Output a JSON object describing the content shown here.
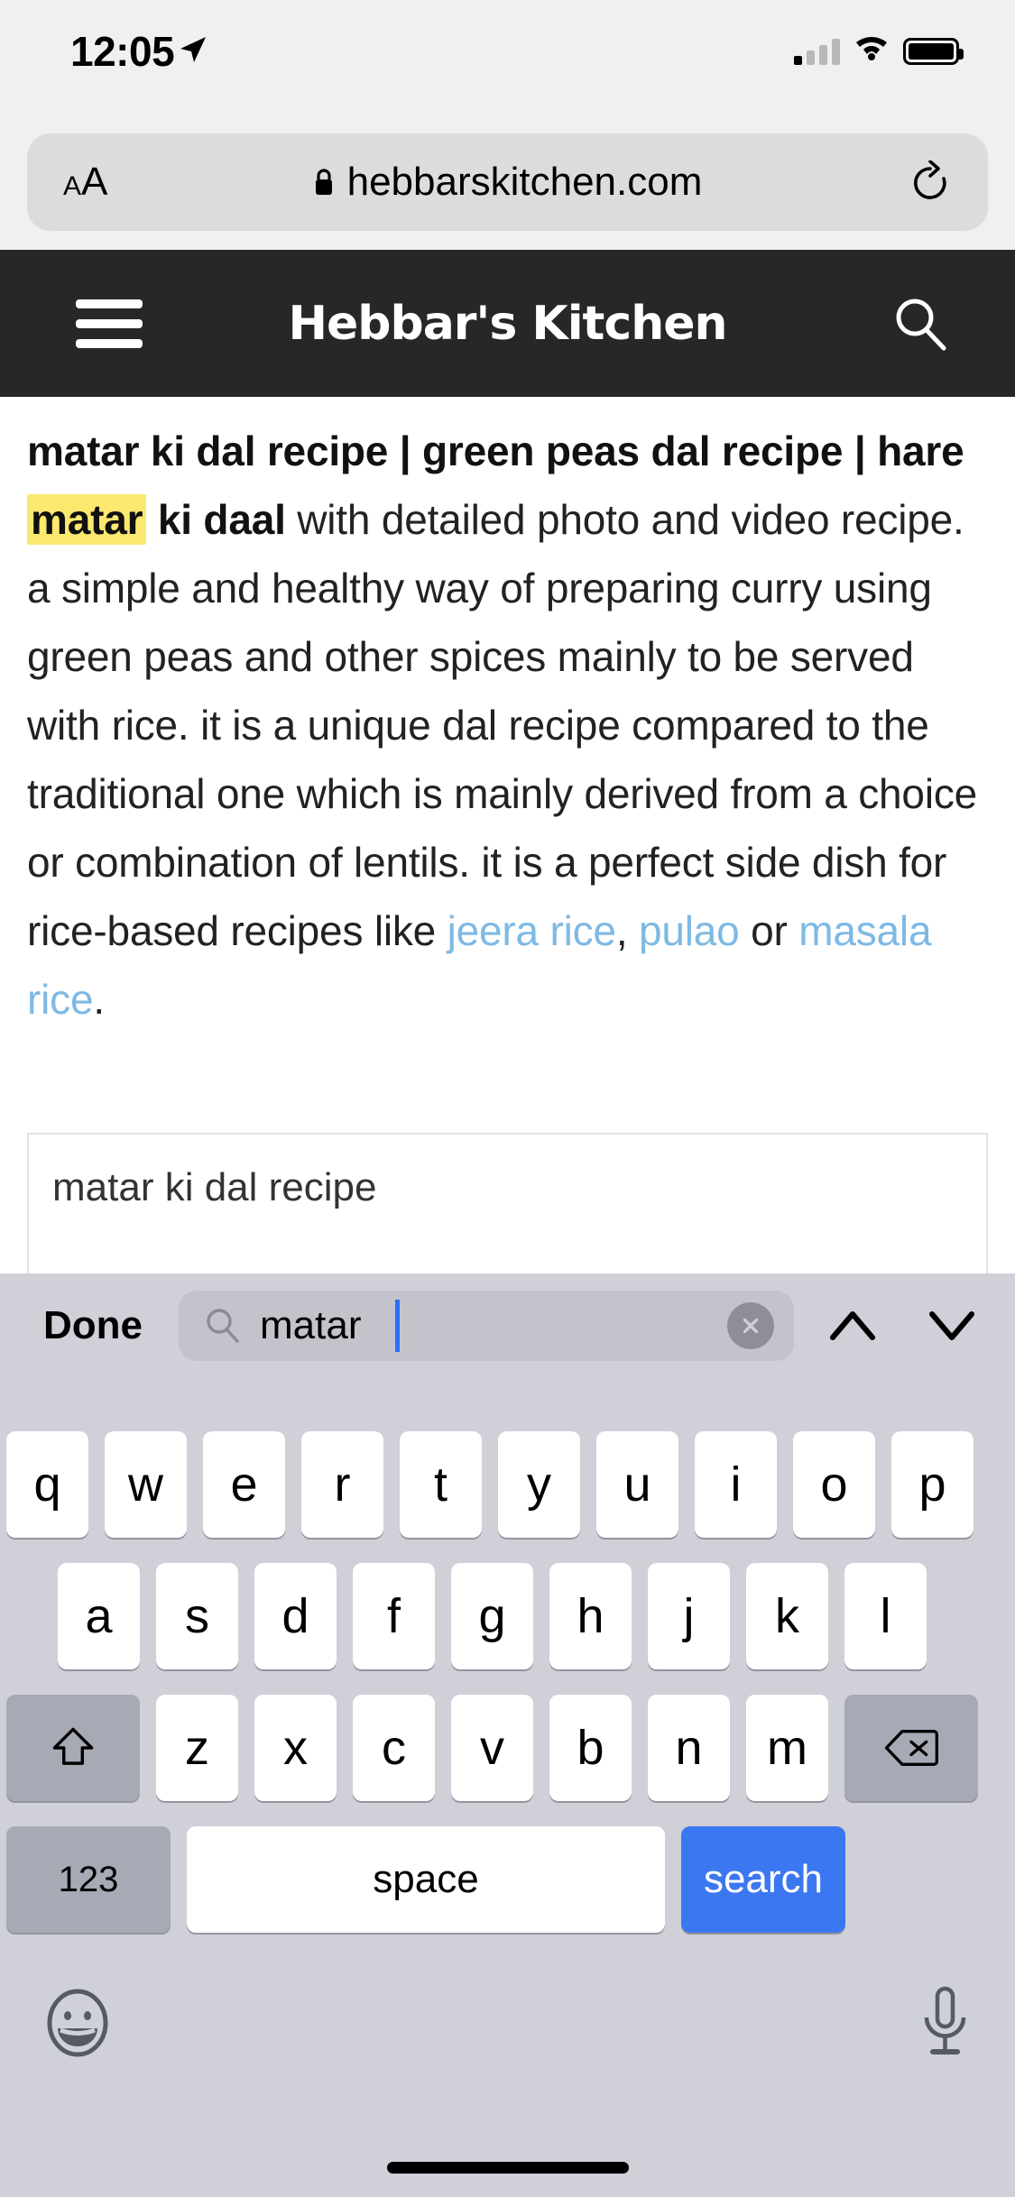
{
  "status_bar": {
    "time": "12:05",
    "location_icon": "location-arrow-icon",
    "cellular_icon": "signal-bars-icon",
    "wifi_icon": "wifi-icon",
    "battery_icon": "battery-full-icon"
  },
  "browser": {
    "text_size_label": "AA",
    "lock_icon": "lock-icon",
    "url": "hebbarskitchen.com",
    "reload_icon": "reload-icon"
  },
  "site_header": {
    "menu_icon": "hamburger-menu-icon",
    "title": "Hebbar's Kitchen",
    "search_icon": "search-icon",
    "background_color": "#272727"
  },
  "article": {
    "bold_part_1": "matar ki dal recipe | green peas dal recipe | hare ",
    "highlight_1": "matar",
    "bold_part_2": " ki daal",
    "body_1": " with detailed photo and video recipe. a simple and healthy way of preparing curry using green peas and other spices mainly to be served with rice. it is a unique dal recipe compared to the traditional one which is mainly derived from a choice or combination of lentils. it is a perfect side dish for rice-based recipes like ",
    "link_1": "jeera rice",
    "sep_1": ", ",
    "link_2": "pulao",
    "sep_2": " or ",
    "link_3": "masala rice",
    "body_end": ".",
    "highlight_color": "#fbe86e",
    "link_color": "#7eb9e4"
  },
  "result_box": {
    "text": "matar ki dal recipe"
  },
  "find_bar": {
    "done_label": "Done",
    "search_icon": "search-icon",
    "query": "matar",
    "clear_icon": "clear-circle-icon",
    "previous_icon": "chevron-up-icon",
    "next_icon": "chevron-down-icon",
    "caret_color": "#2d6ef5"
  },
  "keyboard": {
    "row1": [
      "q",
      "w",
      "e",
      "r",
      "t",
      "y",
      "u",
      "i",
      "o",
      "p"
    ],
    "row2": [
      "a",
      "s",
      "d",
      "f",
      "g",
      "h",
      "j",
      "k",
      "l"
    ],
    "row3_letters": [
      "z",
      "x",
      "c",
      "v",
      "b",
      "n",
      "m"
    ],
    "shift_icon": "shift-arrow-icon",
    "backspace_icon": "backspace-icon",
    "numbers_label": "123",
    "space_label": "space",
    "search_label": "search",
    "search_key_color": "#3b77f0",
    "emoji_icon": "emoji-smiley-icon",
    "mic_icon": "microphone-icon"
  },
  "home_indicator": "home-indicator-bar"
}
